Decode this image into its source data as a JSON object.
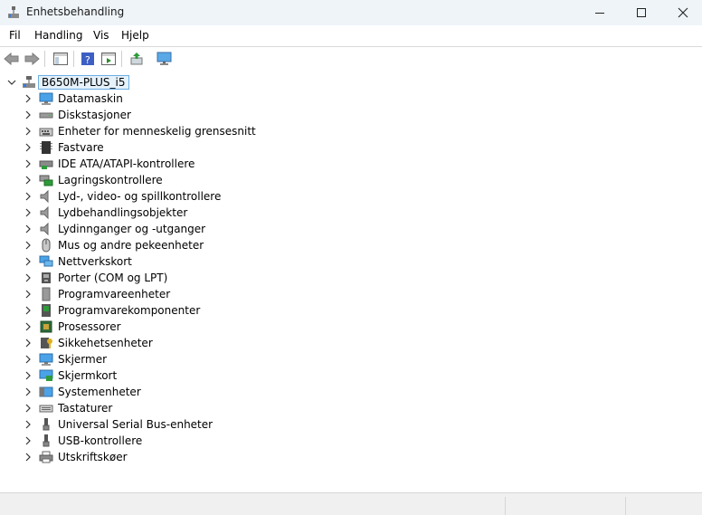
{
  "window": {
    "title": "Enhetsbehandling"
  },
  "menubar": {
    "items": [
      "Fil",
      "Handling",
      "Vis",
      "Hjelp"
    ]
  },
  "tree": {
    "root": "B650M-PLUS_i5",
    "categories": [
      {
        "label": "Datamaskin",
        "icon": "monitor-icon"
      },
      {
        "label": "Diskstasjoner",
        "icon": "disk-drive-icon"
      },
      {
        "label": "Enheter for menneskelig grensesnitt",
        "icon": "hid-icon"
      },
      {
        "label": "Fastvare",
        "icon": "firmware-icon"
      },
      {
        "label": "IDE ATA/ATAPI-kontrollere",
        "icon": "ide-controller-icon"
      },
      {
        "label": "Lagringskontrollere",
        "icon": "storage-controller-icon"
      },
      {
        "label": "Lyd-, video- og spillkontrollere",
        "icon": "speaker-icon"
      },
      {
        "label": "Lydbehandlingsobjekter",
        "icon": "speaker-icon"
      },
      {
        "label": "Lydinnganger og -utganger",
        "icon": "speaker-icon"
      },
      {
        "label": "Mus og andre pekeenheter",
        "icon": "mouse-icon"
      },
      {
        "label": "Nettverkskort",
        "icon": "network-adapter-icon"
      },
      {
        "label": "Porter (COM og LPT)",
        "icon": "port-icon"
      },
      {
        "label": "Programvareenheter",
        "icon": "software-device-icon"
      },
      {
        "label": "Programvarekomponenter",
        "icon": "software-component-icon"
      },
      {
        "label": "Prosessorer",
        "icon": "processor-icon"
      },
      {
        "label": "Sikkehetsenheter",
        "icon": "security-device-icon"
      },
      {
        "label": "Skjermer",
        "icon": "monitor-icon"
      },
      {
        "label": "Skjermkort",
        "icon": "display-adapter-icon"
      },
      {
        "label": "Systemenheter",
        "icon": "system-device-icon"
      },
      {
        "label": "Tastaturer",
        "icon": "keyboard-icon"
      },
      {
        "label": "Universal Serial Bus-enheter",
        "icon": "usb-icon"
      },
      {
        "label": "USB-kontrollere",
        "icon": "usb-icon"
      },
      {
        "label": "Utskriftskøer",
        "icon": "printer-icon"
      }
    ]
  }
}
